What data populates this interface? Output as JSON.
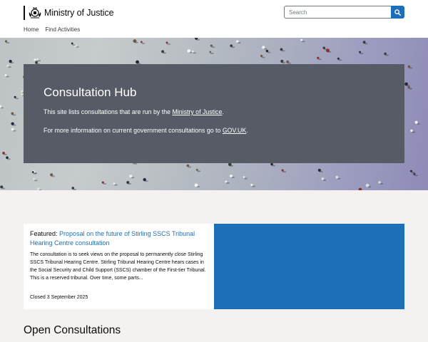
{
  "header": {
    "logo_text": "Ministry of Justice",
    "search_placeholder": "Search"
  },
  "nav": {
    "items": [
      {
        "label": "Home"
      },
      {
        "label": "Find Activities"
      }
    ]
  },
  "hero": {
    "title": "Consultation Hub",
    "intro_prefix": "This site lists consultations that are run by the ",
    "intro_link": "Ministry of Justice",
    "intro_suffix": ".",
    "more_prefix": "For more information on current government consultations go to ",
    "more_link": "GOV.UK",
    "more_suffix": "."
  },
  "featured": {
    "label": "Featured:",
    "title_link": "Proposal on the future of Stirling SSCS Tribunal Hearing Centre consultation",
    "description": "The consultation is to seek views on the proposal to permanently close Stirling SSCS Tribunal Hearing Centre. Stirling Tribunal Hearing Centre hears cases in the Social Security and Child Support (SSCS) chamber of the First-tier Tribunal. This is a reserved tribunal. Over time, some parts...",
    "status": "Closed 3 September 2025"
  },
  "open_consultations": {
    "title": "Open Consultations"
  },
  "colors": {
    "brand_blue": "#1d70b8",
    "hub_box": "#575b66",
    "page_bg": "#f3f2f1"
  },
  "icons": {
    "search": "search-icon",
    "crest": "royal-crest-icon"
  }
}
